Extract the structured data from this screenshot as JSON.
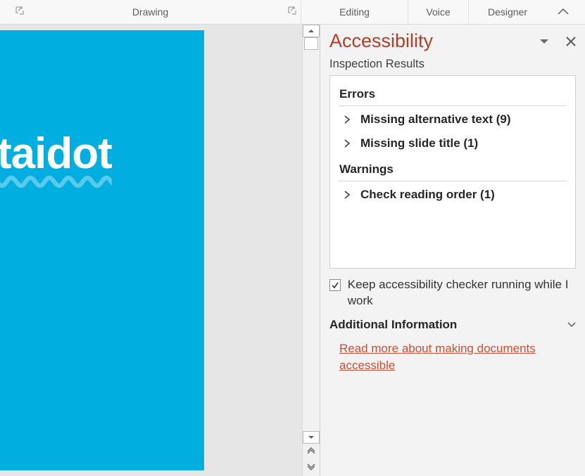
{
  "ribbon": {
    "drawing": "Drawing",
    "editing": "Editing",
    "voice": "Voice",
    "designer": "Designer"
  },
  "slide": {
    "text": "taidot"
  },
  "panel": {
    "title": "Accessibility",
    "subtitle": "Inspection Results",
    "errors_header": "Errors",
    "errors": [
      {
        "label": "Missing alternative text (9)"
      },
      {
        "label": "Missing slide title (1)"
      }
    ],
    "warnings_header": "Warnings",
    "warnings": [
      {
        "label": "Check reading order (1)"
      }
    ],
    "keep_running": "Keep accessibility checker running while I work",
    "additional_header": "Additional Information",
    "link": "Read more about making documents accessible"
  }
}
